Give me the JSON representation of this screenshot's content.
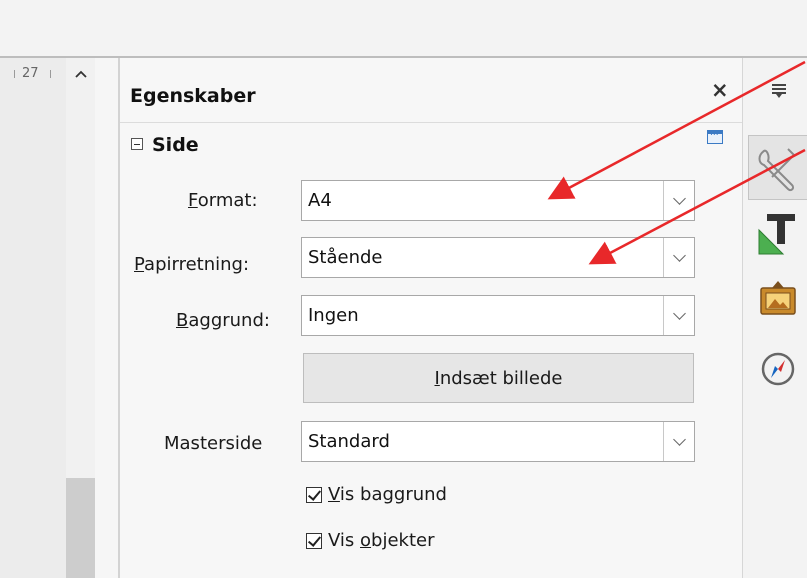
{
  "ruler": {
    "number": "27"
  },
  "panel": {
    "title": "Egenskaber",
    "close_glyph": "×",
    "section_title": "Side"
  },
  "fields": {
    "format": {
      "label_mnemonic": "F",
      "label_rest": "ormat:",
      "value": "A4"
    },
    "orientation": {
      "label_mnemonic": "P",
      "label_rest": "apirretning:",
      "value": "Stående"
    },
    "background": {
      "label_mnemonic": "B",
      "label_rest": "aggrund:",
      "value": "Ingen"
    },
    "master": {
      "label": "Masterside",
      "value": "Standard"
    }
  },
  "insert_button": {
    "mnemonic": "I",
    "rest": "ndsæt billede"
  },
  "checkboxes": {
    "show_background": {
      "checked": true,
      "mnemonic": "V",
      "rest": "is baggrund"
    },
    "show_objects": {
      "checked": true,
      "pre": "Vis ",
      "mnemonic": "o",
      "rest": "bjekter"
    }
  },
  "icons": [
    "scroll-up-icon",
    "close-icon",
    "collapse-section-icon",
    "more-options-icon",
    "sidebar-menu-icon",
    "properties-icon",
    "styles-icon",
    "gallery-icon",
    "navigator-icon",
    "annotation-arrow-icon"
  ],
  "colors": {
    "annotation_arrow": "#e8282a",
    "tab_active": "#e4e4e4"
  }
}
